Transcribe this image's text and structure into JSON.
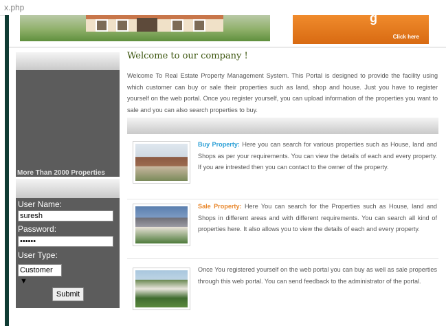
{
  "browser": {
    "address_fragment": "x.php"
  },
  "banner": {
    "promo_text": "g",
    "promo_link": "Click here"
  },
  "sidebar": {
    "marquee": "More Than 2000 Properties",
    "login": {
      "username_label": "User Name:",
      "username_value": "suresh",
      "password_label": "Password:",
      "password_value": "••••••",
      "usertype_label": "User Type:",
      "usertype_value": "Customer",
      "submit_label": "Submit"
    }
  },
  "main": {
    "welcome_title": "Welcome to our company !",
    "intro": "Welcome To Real Estate Property Management System. This Portal is designed to provide the facility using which customer can buy or sale their properties such as land, shop and house. Just you have to register yourself on the web portal. Once you register yourself, you can upload information of the properties you want to sale and you can also search properties to buy.",
    "features": [
      {
        "title": "Buy Property:",
        "text": "Here you can search for various properties such as House, land and Shops as per your requirements. You can view the details of each and every property. If you are intrested then you can contact to the owner of the property."
      },
      {
        "title": "Sale Property:",
        "text": "Here You can search for the Properties such as House, land and Shops in different areas and with different requirements. You can search all kind of properties here. It also allows you to view the details of each and every property."
      },
      {
        "title": "",
        "text": "Once You registered yourself on the web portal you can buy as well as sale properties through this web portal. You can send feedback to the administrator of the portal."
      }
    ]
  },
  "colors": {
    "accent_blue": "#2a9fd6",
    "accent_orange": "#e8862a",
    "title_green": "#39530b",
    "sidebar_gray": "#5c5c5c"
  }
}
